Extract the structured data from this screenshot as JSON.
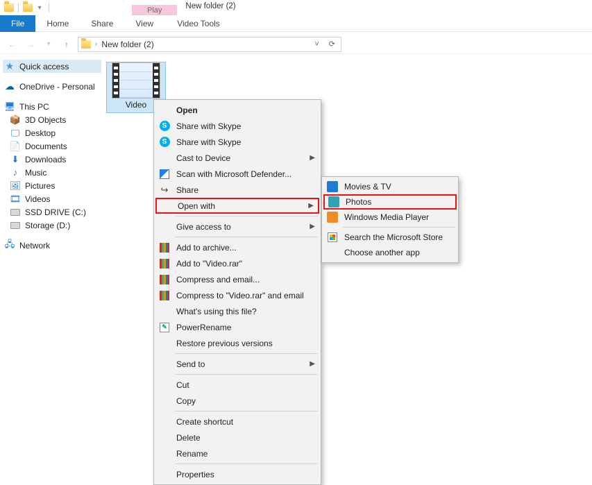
{
  "window": {
    "title": "New folder (2)",
    "context_tab": "Play",
    "context_tool": "Video Tools"
  },
  "ribbon": {
    "file": "File",
    "tabs": [
      "Home",
      "Share",
      "View"
    ],
    "tool_tab": "Video Tools"
  },
  "address": {
    "location": "New folder (2)"
  },
  "sidebar": {
    "quick": "Quick access",
    "onedrive": "OneDrive - Personal",
    "thispc": "This PC",
    "items": [
      "3D Objects",
      "Desktop",
      "Documents",
      "Downloads",
      "Music",
      "Pictures",
      "Videos",
      "SSD DRIVE (C:)",
      "Storage (D:)"
    ],
    "network": "Network"
  },
  "file": {
    "name": "Video"
  },
  "ctx": {
    "open": "Open",
    "skype1": "Share with Skype",
    "skype2": "Share with Skype",
    "cast": "Cast to Device",
    "defender": "Scan with Microsoft Defender...",
    "share": "Share",
    "openwith": "Open with",
    "giveaccess": "Give access to",
    "addarchive": "Add to archive...",
    "addrar": "Add to \"Video.rar\"",
    "compressemail": "Compress and email...",
    "compressraremail": "Compress to \"Video.rar\" and email",
    "whatsusing": "What's using this file?",
    "powerrename": "PowerRename",
    "restore": "Restore previous versions",
    "sendto": "Send to",
    "cut": "Cut",
    "copy": "Copy",
    "createshortcut": "Create shortcut",
    "delete": "Delete",
    "rename": "Rename",
    "properties": "Properties"
  },
  "submenu": {
    "movies": "Movies & TV",
    "photos": "Photos",
    "wmp": "Windows Media Player",
    "store": "Search the Microsoft Store",
    "choose": "Choose another app"
  }
}
